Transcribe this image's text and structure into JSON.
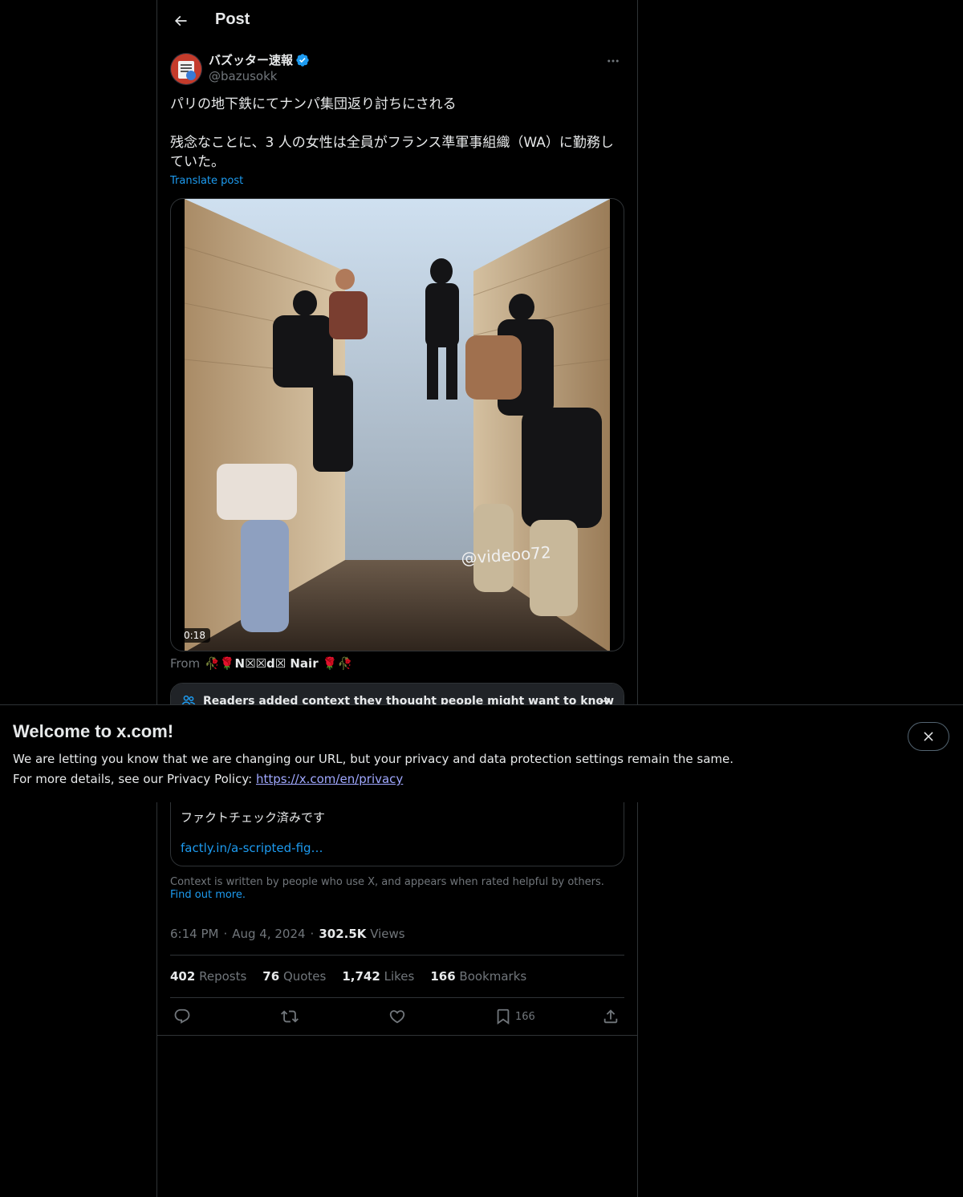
{
  "header": {
    "title": "Post"
  },
  "author": {
    "display_name": "バズッター速報",
    "handle": "@bazusokk",
    "verified": true
  },
  "post": {
    "text": "パリの地下鉄にてナンパ集団返り討ちにされる\n\n残念なことに、3 人の女性は全員がフランス準軍事組織（WA）に勤務していた。",
    "translate_label": "Translate post"
  },
  "media": {
    "duration": "0:18",
    "watermark": "@videoo72"
  },
  "source": {
    "prefix": "From",
    "name": "🥀🌹N☒☒d☒ Nair 🌹🥀"
  },
  "community_note": {
    "heading": "Readers added context they thought people might want to know",
    "body": "ファクトチェック済みです",
    "link": "factly.in/a-scripted-fig…"
  },
  "context_note": {
    "text": "Context is written by people who use X, and appears when rated helpful by others.",
    "link": "Find out more."
  },
  "meta": {
    "time": "6:14 PM",
    "date": "Aug 4, 2024",
    "views_count": "302.5K",
    "views_label": "Views"
  },
  "stats": {
    "reposts_count": "402",
    "reposts_label": "Reposts",
    "quotes_count": "76",
    "quotes_label": "Quotes",
    "likes_count": "1,742",
    "likes_label": "Likes",
    "bookmarks_count": "166",
    "bookmarks_label": "Bookmarks"
  },
  "actions": {
    "bookmark_count": "166"
  },
  "banner": {
    "title": "Welcome to x.com!",
    "line1": "We are letting you know that we are changing our URL, but your privacy and data protection settings remain the same.",
    "line2_prefix": "For more details, see our Privacy Policy:",
    "link": "https://x.com/en/privacy"
  },
  "colors": {
    "background": "#000000",
    "accent": "#1d9bf0",
    "text_primary": "#e7e9ea",
    "text_secondary": "#71767b",
    "border": "#2f3336"
  }
}
